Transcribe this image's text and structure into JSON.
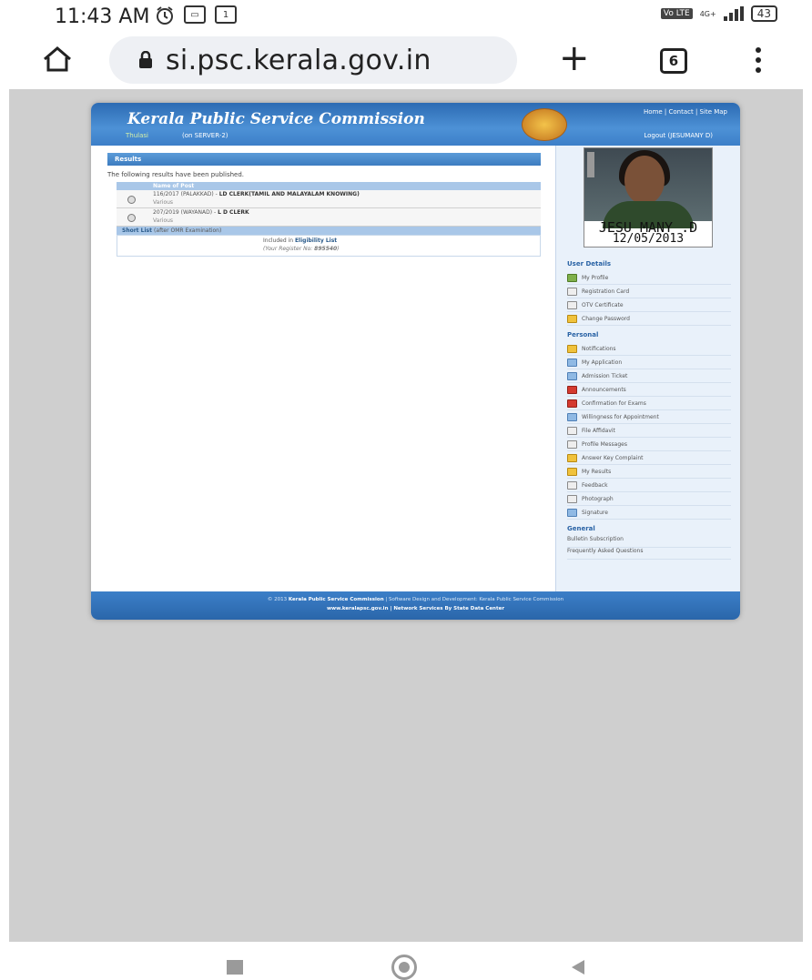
{
  "status": {
    "time": "11:43 AM",
    "network": "4G+",
    "lte": "Vo LTE",
    "battery": "43"
  },
  "browser": {
    "url": "si.psc.kerala.gov.in",
    "tab_count": "6"
  },
  "site": {
    "title": "Kerala Public Service Commission",
    "sub_logo": "Thulasi",
    "server": "(on SERVER-2)",
    "top_links": "Home | Contact | Site Map",
    "logout": "Logout (JESUMANY D)"
  },
  "results": {
    "heading": "Results",
    "intro": "The following results have been published.",
    "col_header": "Name of Post",
    "rows": [
      {
        "prefix": "116/2017 (PALAKKAD) - ",
        "post": "LD CLERK(TAMIL AND MALAYALAM KNOWING)",
        "sub": "Various"
      },
      {
        "prefix": "207/2019 (WAYANAD) - ",
        "post": "L D CLERK",
        "sub": "Various"
      }
    ],
    "shortlist_label": "Short List",
    "shortlist_note": "(after OMR Examination)",
    "included_prefix": "Included in ",
    "included_list": "Eligibility List",
    "register_label": "(Your Register No: ",
    "register_no": "895540",
    "register_suffix": ")"
  },
  "profile": {
    "name": "JESU MANY .D",
    "date": "12/05/2013"
  },
  "sidebar": {
    "user_details_title": "User Details",
    "user_details": [
      {
        "label": "My Profile",
        "icon": "profile-icon"
      },
      {
        "label": "Registration Card",
        "icon": "card-icon"
      },
      {
        "label": "OTV Certificate",
        "icon": "certificate-icon"
      },
      {
        "label": "Change Password",
        "icon": "key-icon"
      }
    ],
    "personal_title": "Personal",
    "personal": [
      {
        "label": "Notifications",
        "icon": "notification-icon"
      },
      {
        "label": "My Application",
        "icon": "application-icon"
      },
      {
        "label": "Admission Ticket",
        "icon": "ticket-icon"
      },
      {
        "label": "Announcements",
        "icon": "megaphone-icon"
      },
      {
        "label": "Confirmation for Exams",
        "icon": "confirmation-icon"
      },
      {
        "label": "Willingness for Appointment",
        "icon": "willingness-icon"
      },
      {
        "label": "File Affidavit",
        "icon": "affidavit-icon"
      },
      {
        "label": "Profile Messages",
        "icon": "message-icon"
      },
      {
        "label": "Answer Key Complaint",
        "icon": "pencil-icon"
      },
      {
        "label": "My Results",
        "icon": "results-icon"
      },
      {
        "label": "Feedback",
        "icon": "feedback-icon"
      },
      {
        "label": "Photograph",
        "icon": "photo-icon"
      },
      {
        "label": "Signature",
        "icon": "signature-icon"
      }
    ],
    "general_title": "General",
    "general": [
      {
        "label": "Bulletin Subscription"
      },
      {
        "label": "Frequently Asked Questions"
      }
    ]
  },
  "footer": {
    "line1_prefix": "© 2013 ",
    "line1_org": "Kerala Public Service Commission",
    "line1_rest": " | Software Design and Development: Kerala Public Service Commission",
    "line2": "www.keralapsc.gov.in | Network Services By State Data Center"
  }
}
